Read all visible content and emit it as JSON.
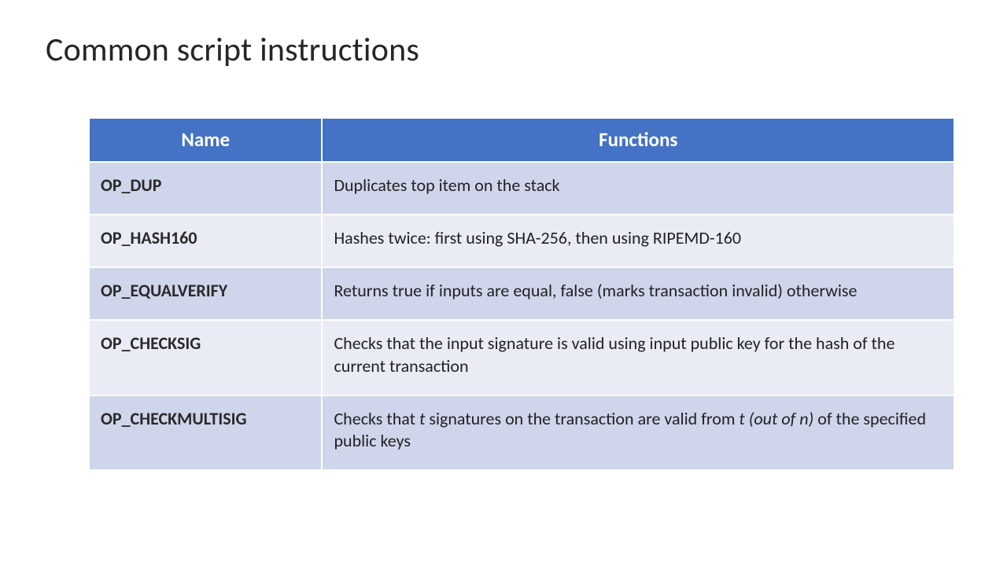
{
  "title": "Common script instructions",
  "headers": {
    "name": "Name",
    "functions": "Functions"
  },
  "rows": [
    {
      "name": "OP_DUP",
      "func_parts": [
        {
          "t": "Duplicates top item on the stack",
          "style": "plain"
        }
      ]
    },
    {
      "name": "OP_HASH160",
      "func_parts": [
        {
          "t": "Hashes twice: first using SHA-256, then using RIPEMD-160",
          "style": "plain"
        }
      ]
    },
    {
      "name": "OP_EQUALVERIFY",
      "func_parts": [
        {
          "t": "Returns true if inputs are equal, false (marks transaction invalid) otherwise",
          "style": "plain"
        }
      ]
    },
    {
      "name": "OP_CHECKSIG",
      "func_parts": [
        {
          "t": "Checks that the input signature is valid using input public key for the hash of the current transaction",
          "style": "plain"
        }
      ]
    },
    {
      "name": "OP_CHECKMULTISIG",
      "func_parts": [
        {
          "t": "Checks that ",
          "style": "plain"
        },
        {
          "t": "t",
          "style": "ital"
        },
        {
          "t": " signatures on the transaction are valid from ",
          "style": "plain"
        },
        {
          "t": "t (out of n)",
          "style": "ital"
        },
        {
          "t": " of the specified public keys",
          "style": "plain"
        }
      ]
    }
  ]
}
